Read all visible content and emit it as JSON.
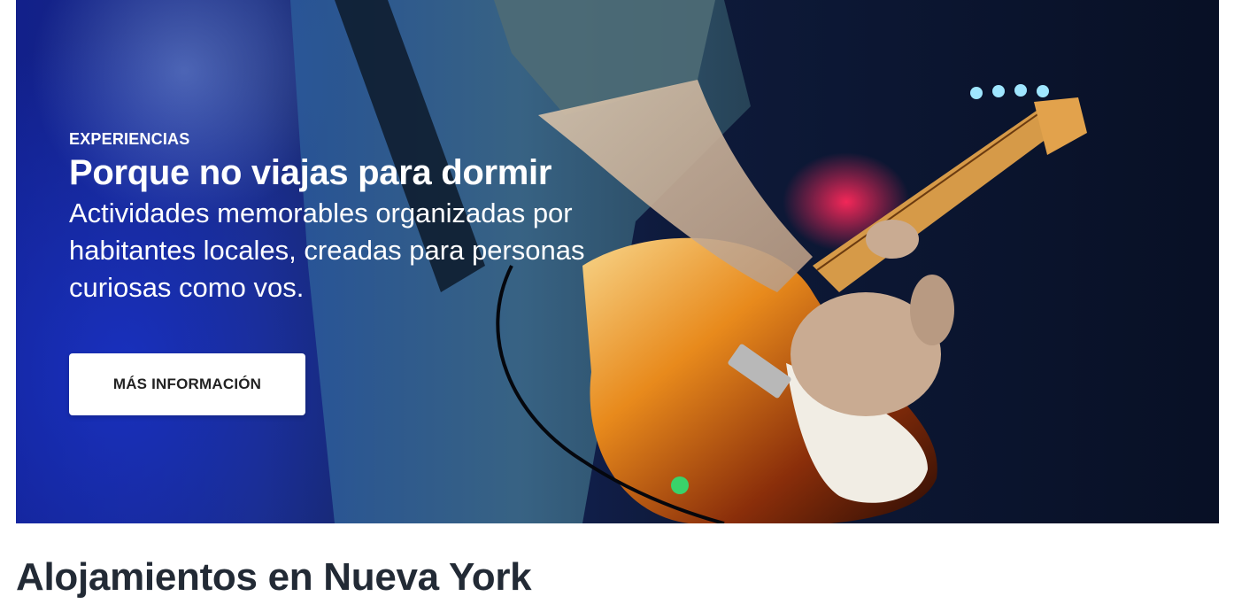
{
  "hero": {
    "eyebrow": "EXPERIENCIAS",
    "title": "Porque no viajas para dormir",
    "subtitle": "Actividades memorables organizadas por habitantes locales, creadas para personas curiosas como vos.",
    "cta_label": "MÁS INFORMACIÓN",
    "image": "guitarist-concert-photo"
  },
  "section": {
    "title": "Alojamientos en Nueva York"
  },
  "colors": {
    "hero_text": "#ffffff",
    "cta_background": "#ffffff",
    "cta_text": "#222222",
    "section_title": "#222a35"
  }
}
